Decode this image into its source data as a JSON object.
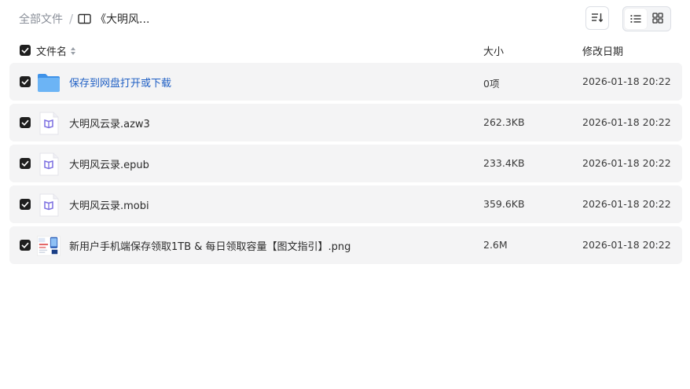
{
  "breadcrumb": {
    "root": "全部文件",
    "separator": "/",
    "current": "《大明风..."
  },
  "toolbar": {
    "sort_icon": "sort-lines-icon",
    "view_list_icon": "list-view-icon",
    "view_grid_icon": "grid-view-icon",
    "active_view": "list"
  },
  "columns": {
    "name": "文件名",
    "size": "大小",
    "date": "修改日期"
  },
  "files": [
    {
      "name": "保存到网盘打开或下载",
      "size": "0项",
      "date": "2026-01-18 20:22",
      "type": "folder",
      "checked": true
    },
    {
      "name": "大明风云录.azw3",
      "size": "262.3KB",
      "date": "2026-01-18 20:22",
      "type": "ebook",
      "checked": true
    },
    {
      "name": "大明风云录.epub",
      "size": "233.4KB",
      "date": "2026-01-18 20:22",
      "type": "ebook",
      "checked": true
    },
    {
      "name": "大明风云录.mobi",
      "size": "359.6KB",
      "date": "2026-01-18 20:22",
      "type": "ebook",
      "checked": true
    },
    {
      "name": "新用户手机端保存领取1TB & 每日领取容量【图文指引】.png",
      "size": "2.6M",
      "date": "2026-01-18 20:22",
      "type": "image",
      "checked": true
    }
  ],
  "colors": {
    "row_bg": "#f4f4f5",
    "link": "#1f5fc4",
    "checkbox": "#1f1f1f",
    "ebook_accent": "#7b6ee0",
    "folder": "#5aa6f0"
  }
}
